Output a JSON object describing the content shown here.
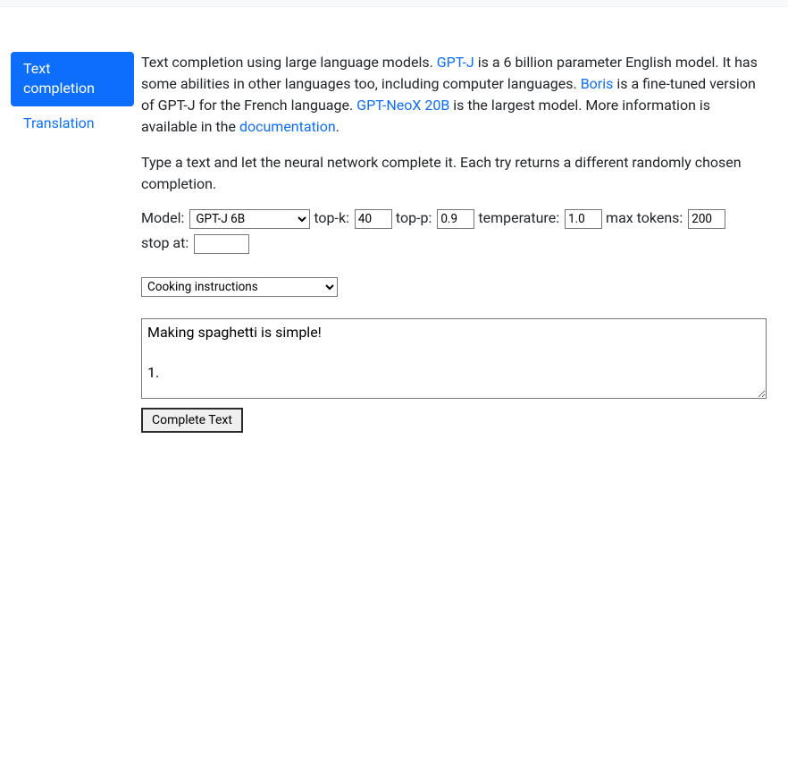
{
  "sidebar": {
    "tabs": [
      {
        "label": "Text completion",
        "active": true
      },
      {
        "label": "Translation",
        "active": false
      }
    ]
  },
  "description": {
    "part1": "Text completion using large language models. ",
    "link1": "GPT-J",
    "part2": " is a 6 billion parameter English model. It has some abilities in other languages too, including computer languages. ",
    "link2": "Boris",
    "part3": " is a fine-tuned version of GPT-J for the French language. ",
    "link3": "GPT-NeoX 20B",
    "part4": " is the largest model. More information is available in the ",
    "link4": "documentation",
    "part5": "."
  },
  "instructions": "Type a text and let the neural network complete it. Each try returns a different randomly chosen completion.",
  "params": {
    "model": {
      "label": "Model:",
      "value": "GPT-J 6B"
    },
    "topk": {
      "label": "top-k:",
      "value": "40"
    },
    "topp": {
      "label": "top-p:",
      "value": "0.9"
    },
    "temperature": {
      "label": "temperature:",
      "value": "1.0"
    },
    "max_tokens": {
      "label": "max tokens:",
      "value": "200"
    },
    "stop_at": {
      "label": "stop at:",
      "value": ""
    }
  },
  "example": {
    "selected": "Cooking instructions"
  },
  "prompt": {
    "text": "Making spaghetti is simple!\n\n1."
  },
  "complete_button": "Complete Text"
}
